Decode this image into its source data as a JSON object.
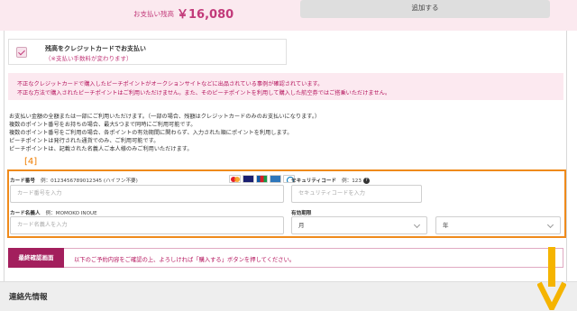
{
  "summary": {
    "balance_label": "お支払い残高",
    "balance_value": "￥16,080",
    "add_button": "追加する"
  },
  "credit_option": {
    "title": "残高をクレジットカードでお支払い",
    "note": "（※支払い手数料が変わります）",
    "checked": true
  },
  "warning": {
    "lines": [
      "不正なクレジットカードで購入したピーチポイントがオークションサイトなどに出品されている事例が確認されています。",
      "不正な方法で購入されたピーチポイントはご利用いただけません。また、そのピーチポイントを利用して購入した航空券ではご搭乗いただけません。"
    ]
  },
  "info": {
    "lines": [
      "お支払い金額の全額または一部にご利用いただけます。（一部の場合、残額はクレジットカードのみのお支払いになります。）",
      "複数のポイント番号をお持ちの場合、最大5つまで同時にご利用可能です。",
      "複数のポイント番号をご利用の場合、各ポイントの有効期間に関わらず、入力された順にポイントを利用します。",
      "ピーチポイントは発行された通貨でのみ、ご利用可能です。",
      "ピーチポイントは、記載された名義人ご本人様のみご利用いただけます。"
    ]
  },
  "marker": "[4]",
  "card_form": {
    "card_number": {
      "label": "カード番号",
      "hint": "例：0123456789012345 (ハイフン不要)",
      "placeholder": "カード番号を入力"
    },
    "security_code": {
      "label": "セキュリティコード",
      "hint": "例：123",
      "placeholder": "セキュリティコードを入力"
    },
    "card_holder": {
      "label": "カード名義人",
      "hint": "例：MOMOKO INOUE",
      "placeholder": "カード名義人を入力"
    },
    "expiry": {
      "label": "有効期限",
      "month": "月",
      "year": "年"
    },
    "card_logos": [
      "mastercard",
      "visa",
      "jcb",
      "amex",
      "diners"
    ]
  },
  "final": {
    "button": "最終確認画面",
    "text": "以下のご予約内容をご確認の上、よろしければ「購入する」ボタンを押してください。"
  },
  "contact": {
    "title": "連絡先情報"
  },
  "colors": {
    "accent": "#c23a7a",
    "brand_button": "#a31f5d",
    "highlight": "#ef8a1b"
  }
}
